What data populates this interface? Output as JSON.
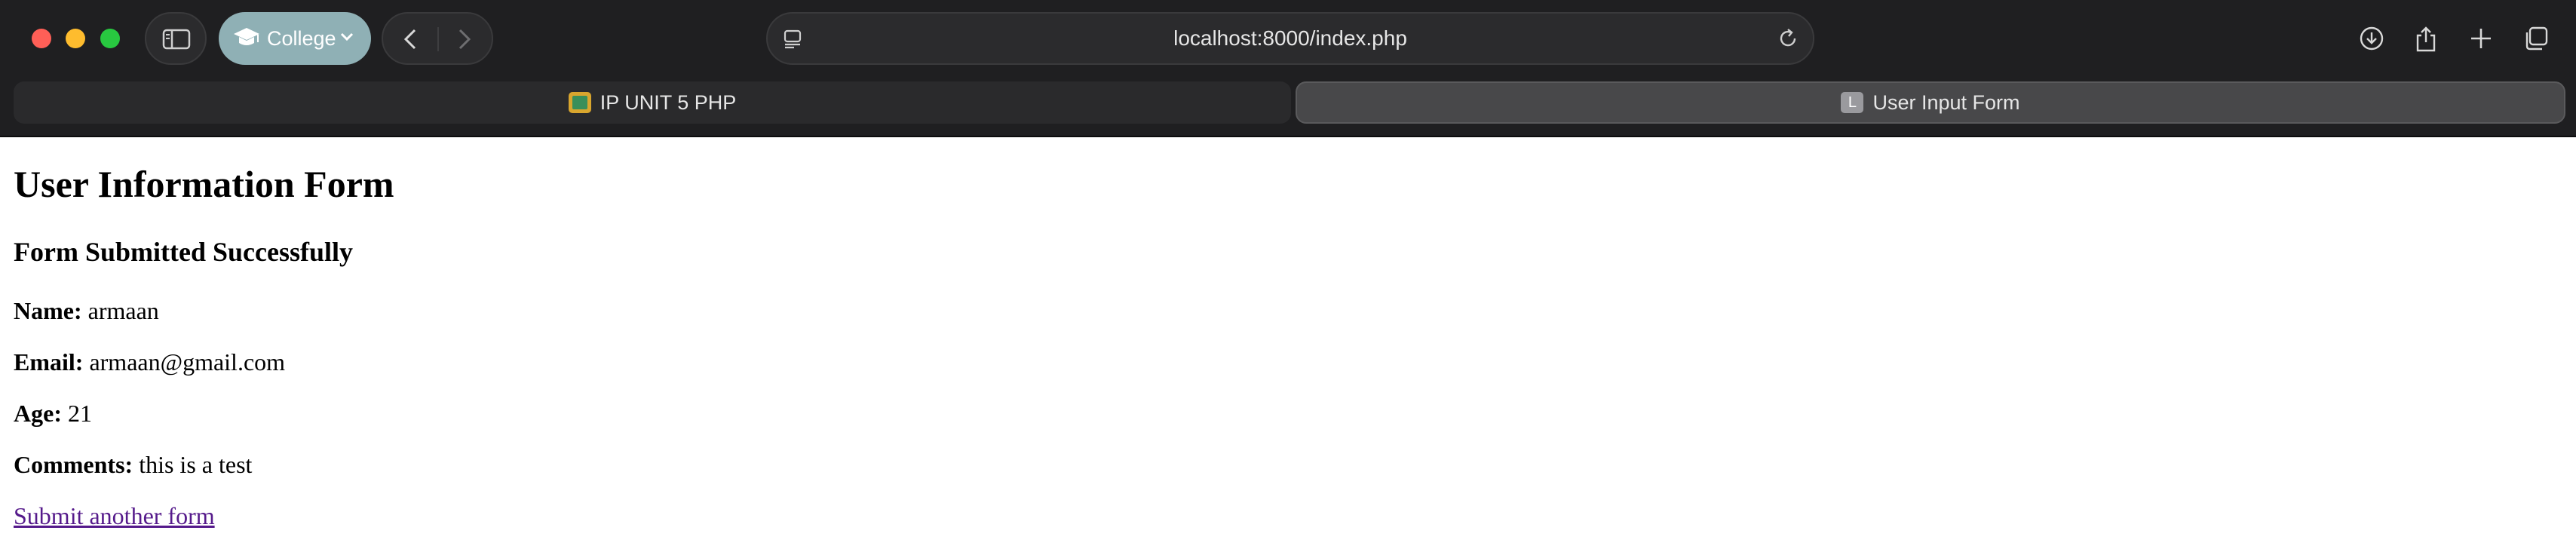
{
  "browser": {
    "profile_label": "College",
    "address": "localhost:8000/index.php",
    "tabs": [
      {
        "title": "IP UNIT 5 PHP",
        "favicon": "image-icon",
        "active": false
      },
      {
        "title": "User Input Form",
        "favicon_letter": "L",
        "active": true
      }
    ],
    "icons": {
      "sidebar": "sidebar-icon",
      "profile": "graduation-cap-icon",
      "back": "chevron-left-icon",
      "forward": "chevron-right-icon",
      "page": "page-menu-icon",
      "reload": "reload-icon",
      "download": "download-icon",
      "share": "share-icon",
      "new_tab": "plus-icon",
      "tab_overview": "tab-overview-icon"
    }
  },
  "page": {
    "heading": "User Information Form",
    "subheading": "Form Submitted Successfully",
    "fields": [
      {
        "label": "Name:",
        "value": "armaan"
      },
      {
        "label": "Email:",
        "value": "armaan@gmail.com"
      },
      {
        "label": "Age:",
        "value": "21"
      },
      {
        "label": "Comments:",
        "value": "this is a test"
      }
    ],
    "link_text": "Submit another form",
    "link_color": "#551a8b"
  }
}
